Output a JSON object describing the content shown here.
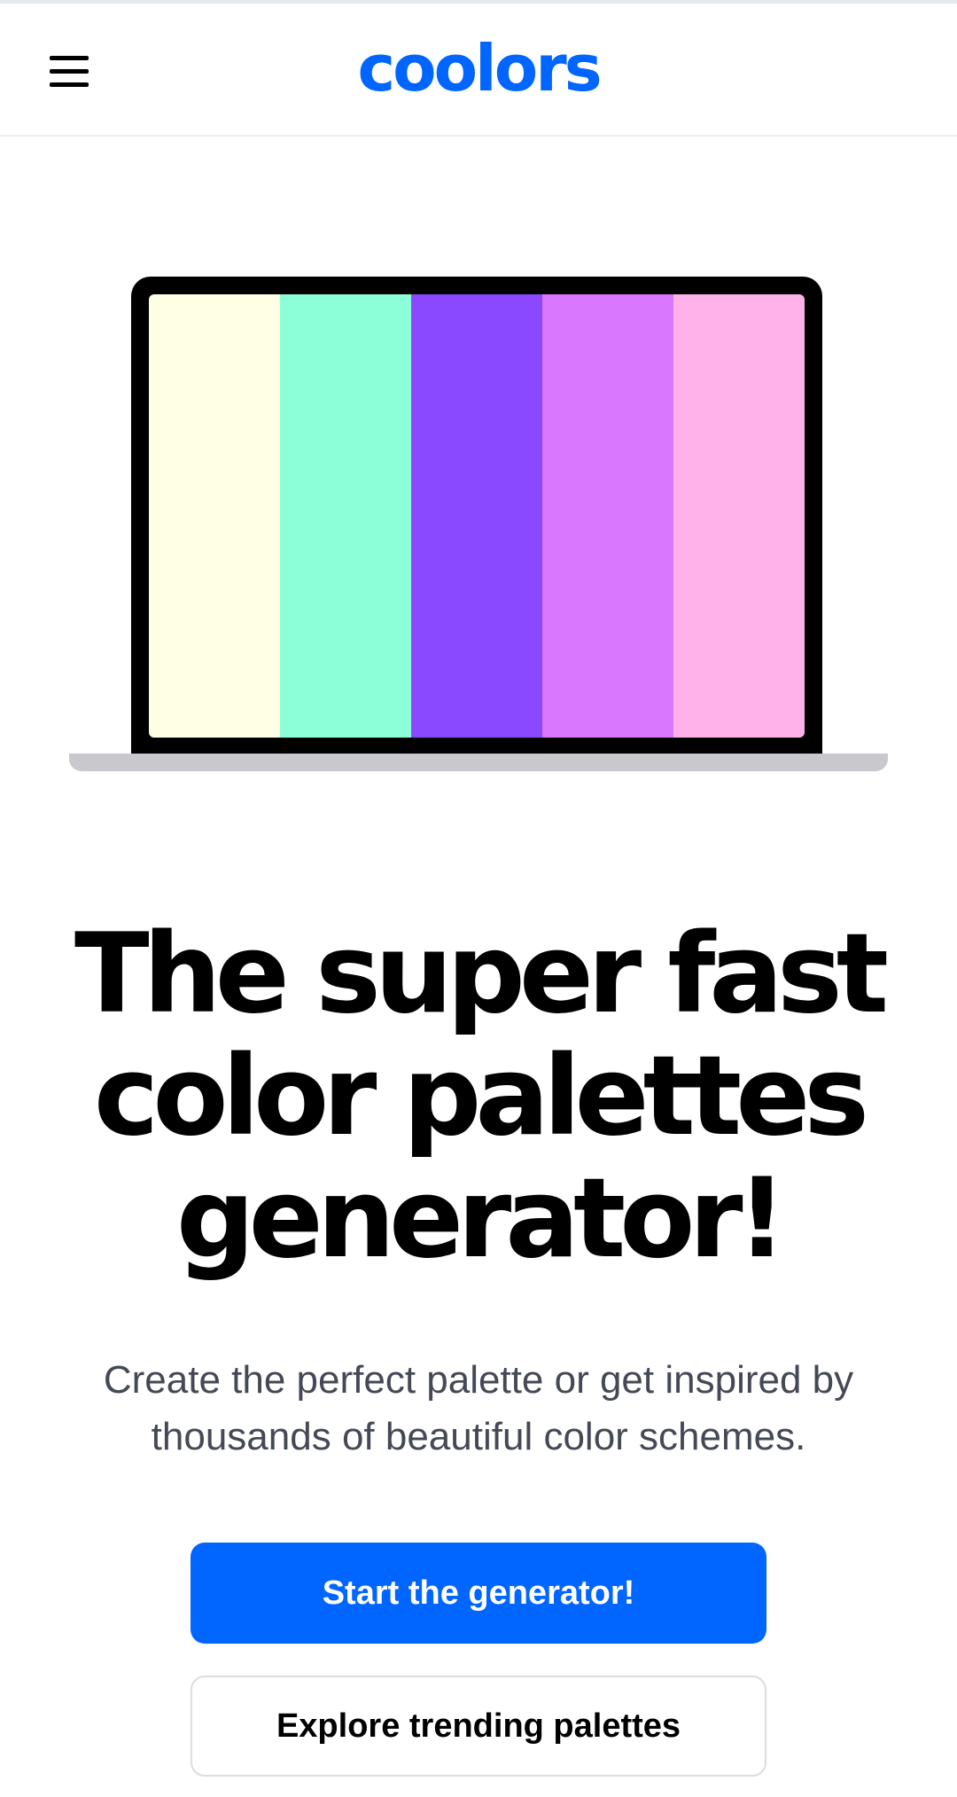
{
  "header": {
    "logo_text": "coolors",
    "menu_icon": "hamburger-menu-icon"
  },
  "hero": {
    "palette": [
      "#ffffe5",
      "#8dffd8",
      "#8a48ff",
      "#d977ff",
      "#ffb2ea"
    ],
    "title_lines": [
      "The super fast",
      "color palettes",
      "generator!"
    ],
    "subtitle_lines": [
      "Create the perfect palette or get inspired by",
      "thousands of beautiful color schemes."
    ]
  },
  "buttons": {
    "primary_label": "Start the generator!",
    "secondary_label": "Explore trending palettes"
  },
  "colors": {
    "brand": "#0066ff",
    "subtitle": "#454956"
  }
}
